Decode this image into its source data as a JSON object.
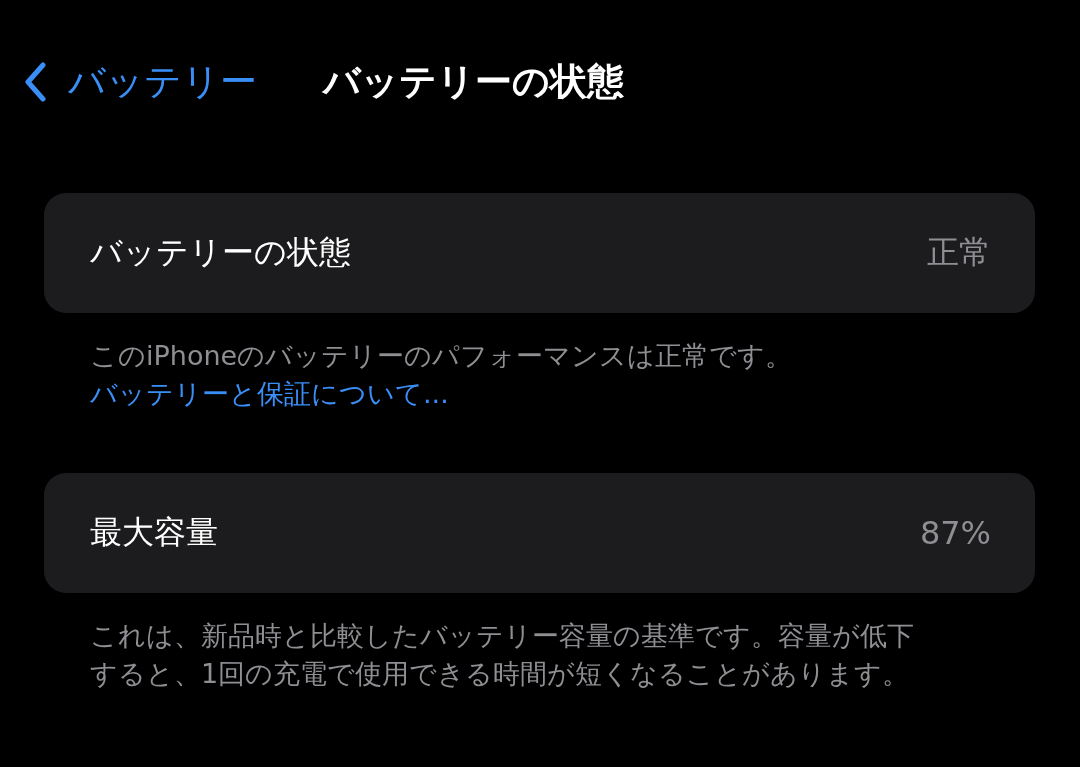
{
  "nav": {
    "back_label": "バッテリー",
    "title": "バッテリーの状態"
  },
  "sections": [
    {
      "label": "バッテリーの状態",
      "value": "正常",
      "footer": {
        "text": "このiPhoneのバッテリーのパフォーマンスは正常です。",
        "link": "バッテリーと保証について..."
      }
    },
    {
      "label": "最大容量",
      "value": "87%",
      "footer": {
        "text": "これは、新品時と比較したバッテリー容量の基準です。容量が低下すると、1回の充電で使用できる時間が短くなることがあります。"
      }
    }
  ]
}
